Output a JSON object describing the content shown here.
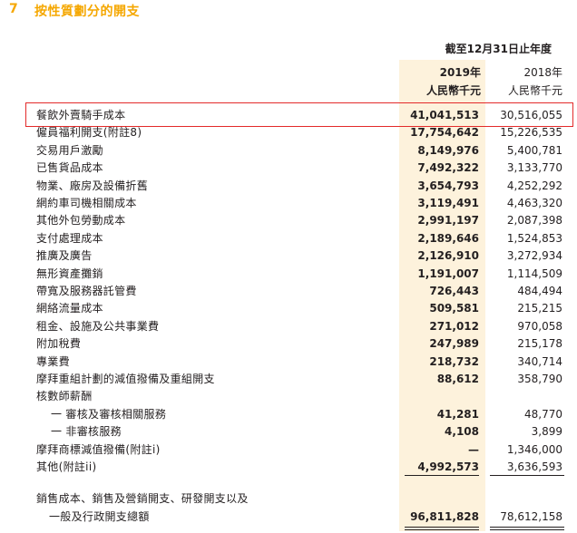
{
  "section": {
    "number": "7",
    "title": "按性質劃分的開支"
  },
  "period_header": "截至12月31日止年度",
  "columns": [
    {
      "year": "2019年",
      "unit": "人民幣千元"
    },
    {
      "year": "2018年",
      "unit": "人民幣千元"
    }
  ],
  "rows": [
    {
      "label": "餐飲外賣騎手成本",
      "v2019": "41,041,513",
      "v2018": "30,516,055",
      "highlighted": true
    },
    {
      "label": "僱員福利開支(附註8)",
      "v2019": "17,754,642",
      "v2018": "15,226,535"
    },
    {
      "label": "交易用戶激勵",
      "v2019": "8,149,976",
      "v2018": "5,400,781"
    },
    {
      "label": "已售貨品成本",
      "v2019": "7,492,322",
      "v2018": "3,133,770"
    },
    {
      "label": "物業、廠房及設備折舊",
      "v2019": "3,654,793",
      "v2018": "4,252,292"
    },
    {
      "label": "網約車司機相關成本",
      "v2019": "3,119,491",
      "v2018": "4,463,320"
    },
    {
      "label": "其他外包勞動成本",
      "v2019": "2,991,197",
      "v2018": "2,087,398"
    },
    {
      "label": "支付處理成本",
      "v2019": "2,189,646",
      "v2018": "1,524,853"
    },
    {
      "label": "推廣及廣告",
      "v2019": "2,126,910",
      "v2018": "3,272,934"
    },
    {
      "label": "無形資產攤銷",
      "v2019": "1,191,007",
      "v2018": "1,114,509"
    },
    {
      "label": "帶寬及服務器託管費",
      "v2019": "726,443",
      "v2018": "484,494"
    },
    {
      "label": "網絡流量成本",
      "v2019": "509,581",
      "v2018": "215,215"
    },
    {
      "label": "租金、設施及公共事業費",
      "v2019": "271,012",
      "v2018": "970,058"
    },
    {
      "label": "附加稅費",
      "v2019": "247,989",
      "v2018": "215,178"
    },
    {
      "label": "專業費",
      "v2019": "218,732",
      "v2018": "340,714"
    },
    {
      "label": "摩拜重組計劃的減值撥備及重組開支",
      "v2019": "88,612",
      "v2018": "358,790"
    },
    {
      "label": "核數師薪酬",
      "v2019": "",
      "v2018": ""
    },
    {
      "label": "一 審核及審核相關服務",
      "v2019": "41,281",
      "v2018": "48,770",
      "indent": true
    },
    {
      "label": "一 非審核服務",
      "v2019": "4,108",
      "v2018": "3,899",
      "indent": true
    },
    {
      "label": "摩拜商標減值撥備(附註i)",
      "v2019": "—",
      "v2018": "1,346,000"
    },
    {
      "label": "其他(附註ii)",
      "v2019": "4,992,573",
      "v2018": "3,636,593"
    }
  ],
  "total": {
    "label_line1": "銷售成本、銷售及營銷開支、研發開支以及",
    "label_line2": "一般及行政開支總額",
    "v2019": "96,811,828",
    "v2018": "78,612,158"
  }
}
